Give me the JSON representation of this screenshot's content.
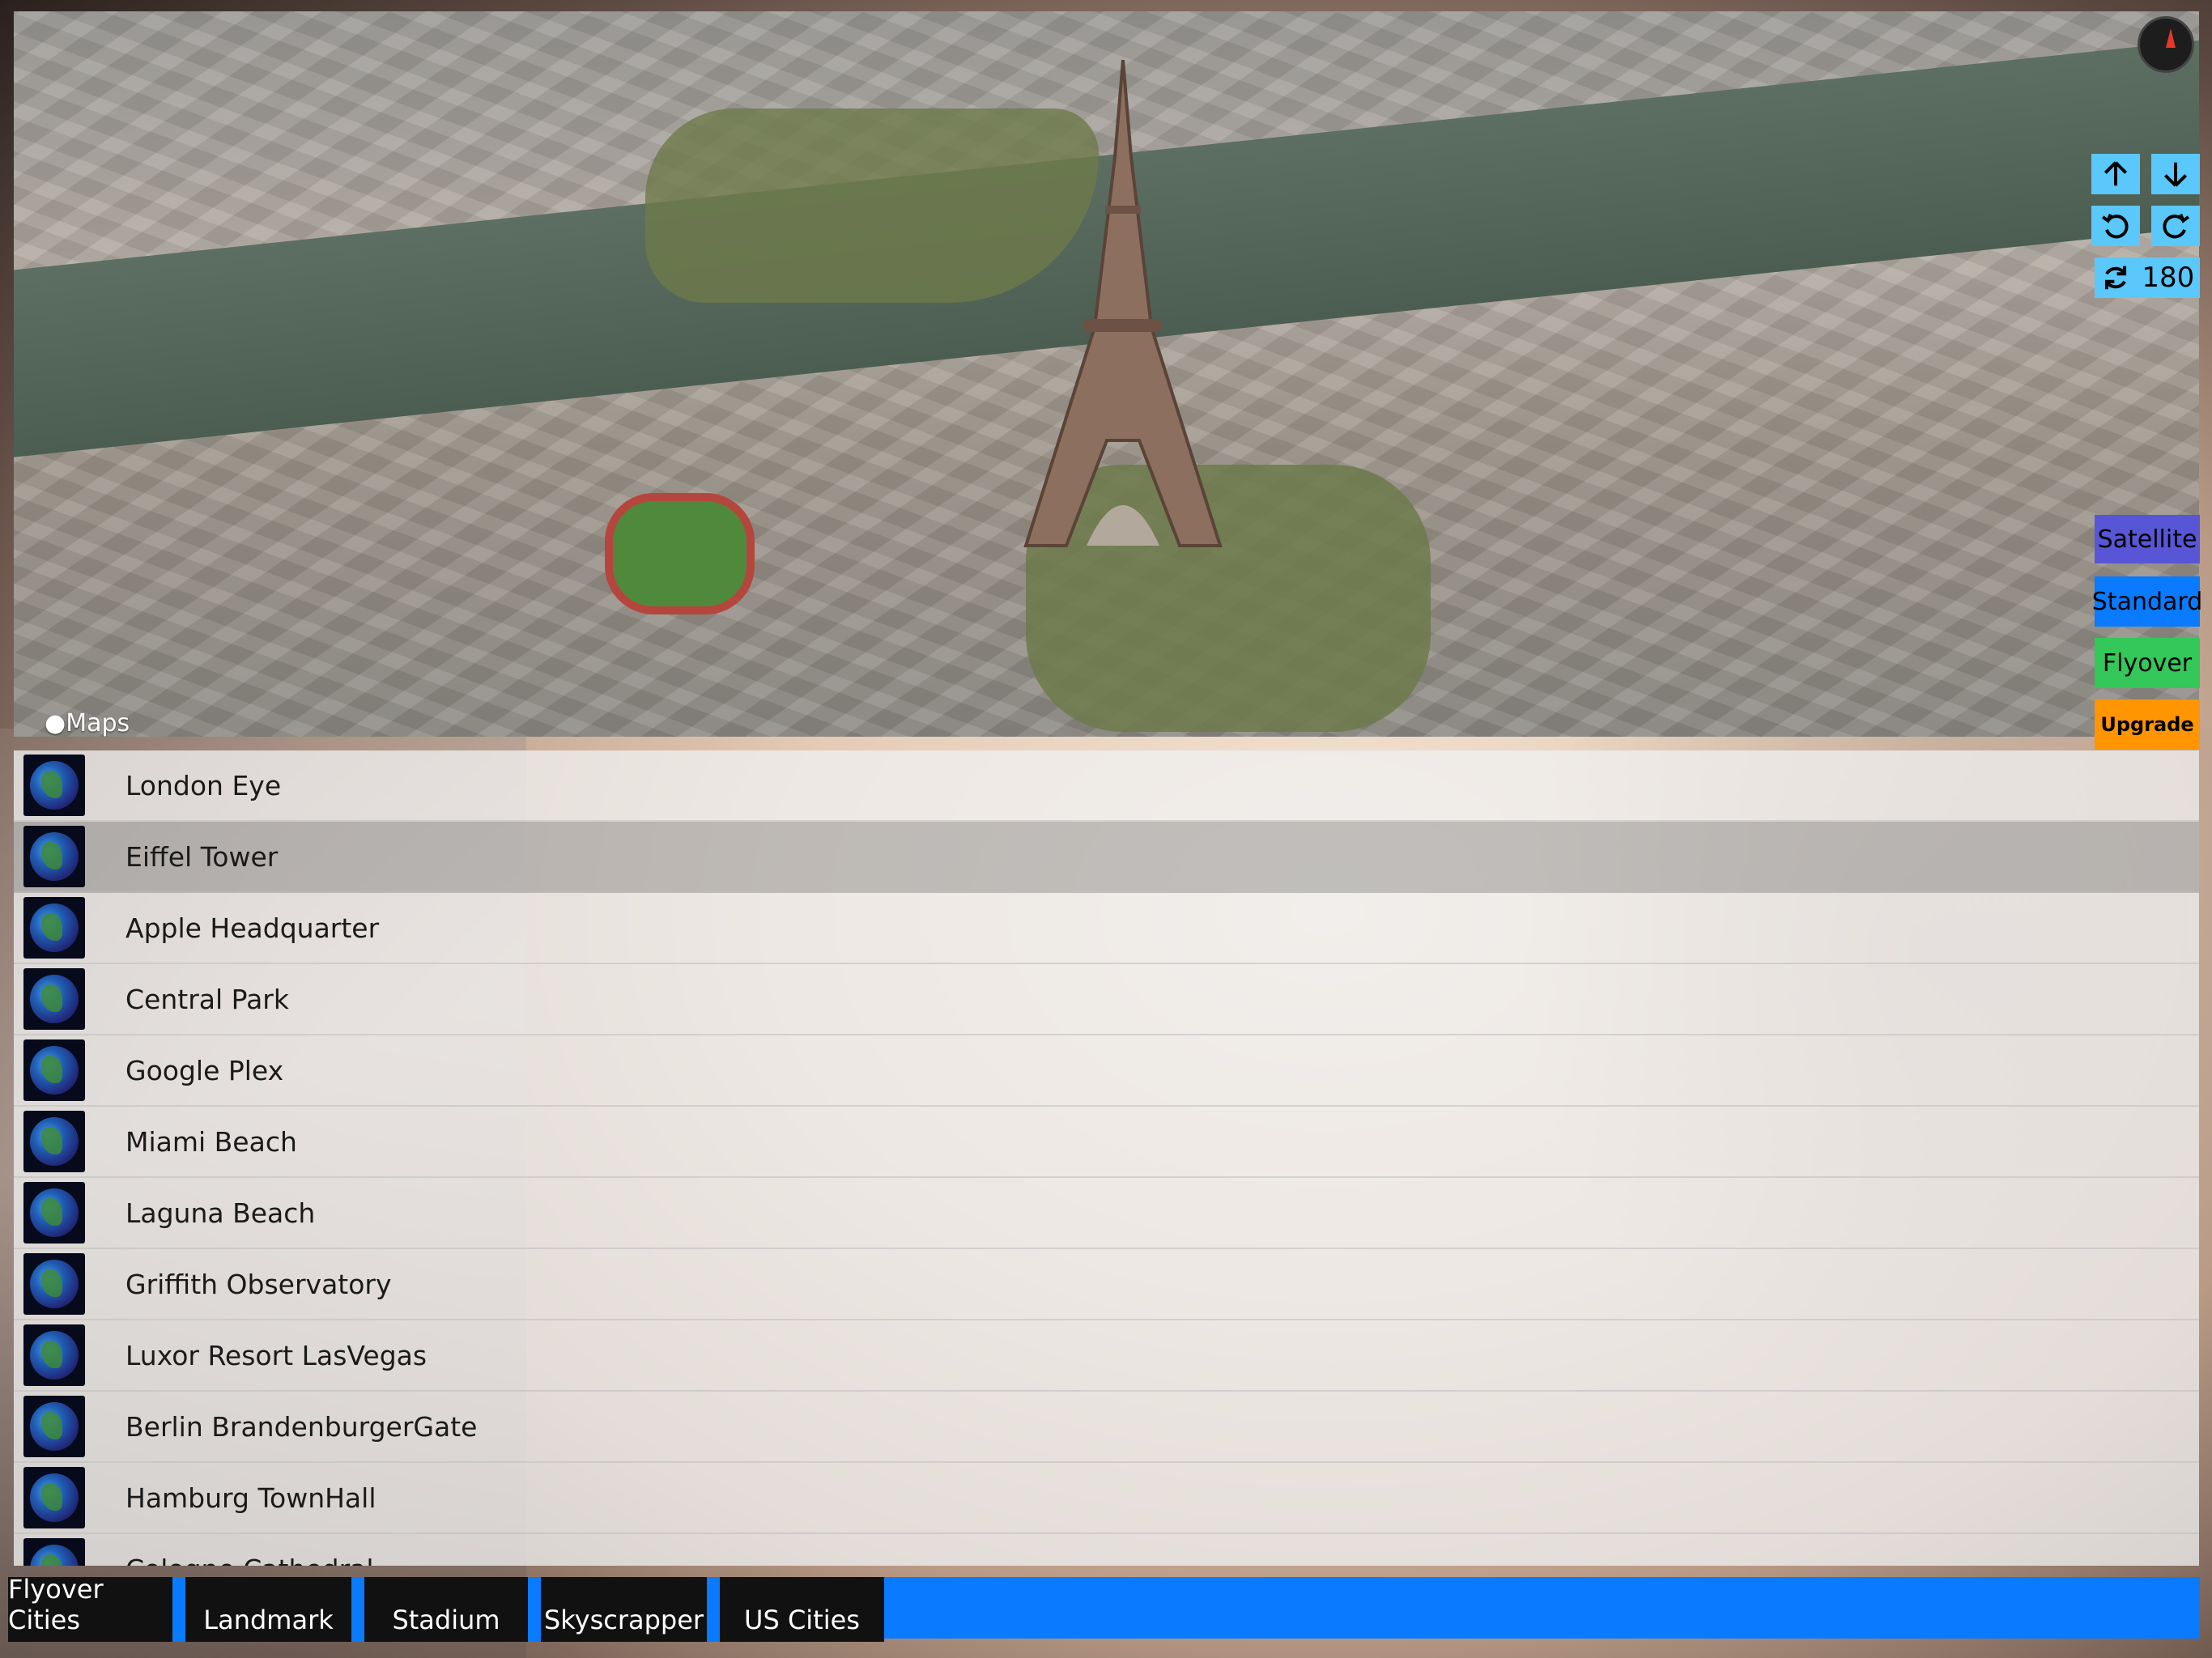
{
  "map": {
    "logo": "Maps",
    "compass_icon": "compass-icon",
    "controls": {
      "tilt_up": "arrow-up-icon",
      "tilt_down": "arrow-down-icon",
      "rotate_left": "rotate-ccw-icon",
      "rotate_right": "rotate-cw-icon",
      "rotate_label": "180"
    },
    "modes": [
      {
        "label": "Satellite",
        "color": "#5856d6"
      },
      {
        "label": "Standard",
        "color": "#0a7aff"
      },
      {
        "label": "Flyover",
        "color": "#34c759"
      },
      {
        "label": "Upgrade",
        "color": "#ff9500"
      }
    ]
  },
  "list": {
    "items": [
      {
        "label": "London Eye"
      },
      {
        "label": "Eiffel Tower",
        "selected": true
      },
      {
        "label": "Apple Headquarter"
      },
      {
        "label": "Central Park"
      },
      {
        "label": "Google Plex"
      },
      {
        "label": "Miami Beach"
      },
      {
        "label": "Laguna Beach"
      },
      {
        "label": "Griffith Observatory"
      },
      {
        "label": "Luxor Resort LasVegas"
      },
      {
        "label": "Berlin BrandenburgerGate"
      },
      {
        "label": "Hamburg TownHall"
      },
      {
        "label": "Cologne Cathedral"
      }
    ]
  },
  "tabs": [
    {
      "label": "Flyover Cities"
    },
    {
      "label": "Landmark"
    },
    {
      "label": "Stadium"
    },
    {
      "label": "Skyscrapper"
    },
    {
      "label": "US Cities"
    }
  ],
  "colors": {
    "control_bg": "#5ac8fa",
    "tab_accent": "#0a7aff"
  }
}
